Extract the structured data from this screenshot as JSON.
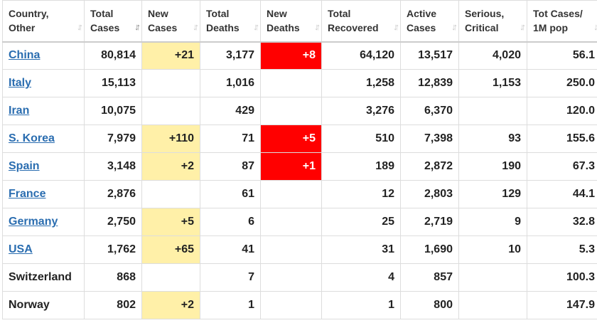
{
  "headers": [
    {
      "line1": "Country,",
      "line2": "Other"
    },
    {
      "line1": "Total",
      "line2": "Cases"
    },
    {
      "line1": "New",
      "line2": "Cases"
    },
    {
      "line1": "Total",
      "line2": "Deaths"
    },
    {
      "line1": "New",
      "line2": "Deaths"
    },
    {
      "line1": "Total",
      "line2": "Recovered"
    },
    {
      "line1": "Active",
      "line2": "Cases"
    },
    {
      "line1": "Serious,",
      "line2": "Critical"
    },
    {
      "line1": "Tot Cases/",
      "line2": "1M pop"
    }
  ],
  "sort_icon": "sort-arrows-icon",
  "colors": {
    "new_cases_highlight": "#fff0a8",
    "new_deaths_highlight": "#ff0000",
    "link": "#2a6db0"
  },
  "rows": [
    {
      "country": "China",
      "link": true,
      "total_cases": "80,814",
      "new_cases": "+21",
      "total_deaths": "3,177",
      "new_deaths": "+8",
      "total_recovered": "64,120",
      "active_cases": "13,517",
      "serious": "4,020",
      "per_million": "56.1"
    },
    {
      "country": "Italy",
      "link": true,
      "total_cases": "15,113",
      "new_cases": "",
      "total_deaths": "1,016",
      "new_deaths": "",
      "total_recovered": "1,258",
      "active_cases": "12,839",
      "serious": "1,153",
      "per_million": "250.0"
    },
    {
      "country": "Iran",
      "link": true,
      "total_cases": "10,075",
      "new_cases": "",
      "total_deaths": "429",
      "new_deaths": "",
      "total_recovered": "3,276",
      "active_cases": "6,370",
      "serious": "",
      "per_million": "120.0"
    },
    {
      "country": "S. Korea",
      "link": true,
      "total_cases": "7,979",
      "new_cases": "+110",
      "total_deaths": "71",
      "new_deaths": "+5",
      "total_recovered": "510",
      "active_cases": "7,398",
      "serious": "93",
      "per_million": "155.6"
    },
    {
      "country": "Spain",
      "link": true,
      "total_cases": "3,148",
      "new_cases": "+2",
      "total_deaths": "87",
      "new_deaths": "+1",
      "total_recovered": "189",
      "active_cases": "2,872",
      "serious": "190",
      "per_million": "67.3"
    },
    {
      "country": "France",
      "link": true,
      "total_cases": "2,876",
      "new_cases": "",
      "total_deaths": "61",
      "new_deaths": "",
      "total_recovered": "12",
      "active_cases": "2,803",
      "serious": "129",
      "per_million": "44.1"
    },
    {
      "country": "Germany",
      "link": true,
      "total_cases": "2,750",
      "new_cases": "+5",
      "total_deaths": "6",
      "new_deaths": "",
      "total_recovered": "25",
      "active_cases": "2,719",
      "serious": "9",
      "per_million": "32.8"
    },
    {
      "country": "USA",
      "link": true,
      "total_cases": "1,762",
      "new_cases": "+65",
      "total_deaths": "41",
      "new_deaths": "",
      "total_recovered": "31",
      "active_cases": "1,690",
      "serious": "10",
      "per_million": "5.3"
    },
    {
      "country": "Switzerland",
      "link": false,
      "total_cases": "868",
      "new_cases": "",
      "total_deaths": "7",
      "new_deaths": "",
      "total_recovered": "4",
      "active_cases": "857",
      "serious": "",
      "per_million": "100.3"
    },
    {
      "country": "Norway",
      "link": false,
      "total_cases": "802",
      "new_cases": "+2",
      "total_deaths": "1",
      "new_deaths": "",
      "total_recovered": "1",
      "active_cases": "800",
      "serious": "",
      "per_million": "147.9"
    }
  ]
}
